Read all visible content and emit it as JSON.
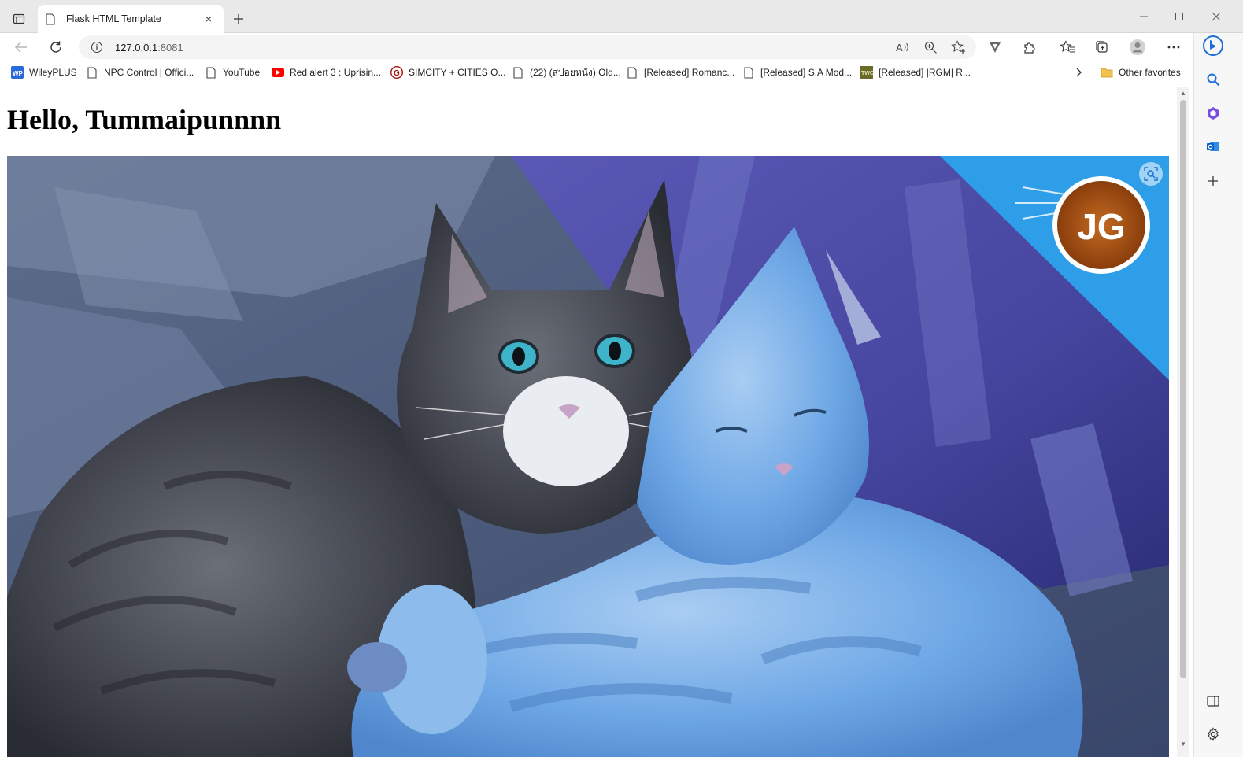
{
  "browser": {
    "tab_title": "Flask HTML Template",
    "tab_close": "×",
    "new_tab": "+",
    "url_host": "127.0.0.1",
    "url_port": ":8081"
  },
  "favorites": {
    "items": [
      {
        "label": "WileyPLUS",
        "icon": "wileyplus-icon"
      },
      {
        "label": "NPC Control | Offici...",
        "icon": "page-icon"
      },
      {
        "label": "YouTube",
        "icon": "page-icon"
      },
      {
        "label": "Red alert 3 : Uprisin...",
        "icon": "youtube-icon"
      },
      {
        "label": "SIMCITY + CITIES O...",
        "icon": "g-logo-icon"
      },
      {
        "label": "(22) (สปอยหนัง) Old...",
        "icon": "page-icon"
      },
      {
        "label": "[Released] Romanc...",
        "icon": "page-icon"
      },
      {
        "label": "[Released] S.A Mod...",
        "icon": "page-icon"
      },
      {
        "label": "[Released] |RGM| R...",
        "icon": "twc-icon"
      }
    ],
    "other_label": "Other favorites"
  },
  "page": {
    "greeting": "Hello, Tummaipunnnn"
  },
  "photo": {
    "badge_text": "JG"
  },
  "colors": {
    "accent": "#0a64d6",
    "badge": "#a44f14",
    "corner_blue": "#2f9ee8"
  }
}
